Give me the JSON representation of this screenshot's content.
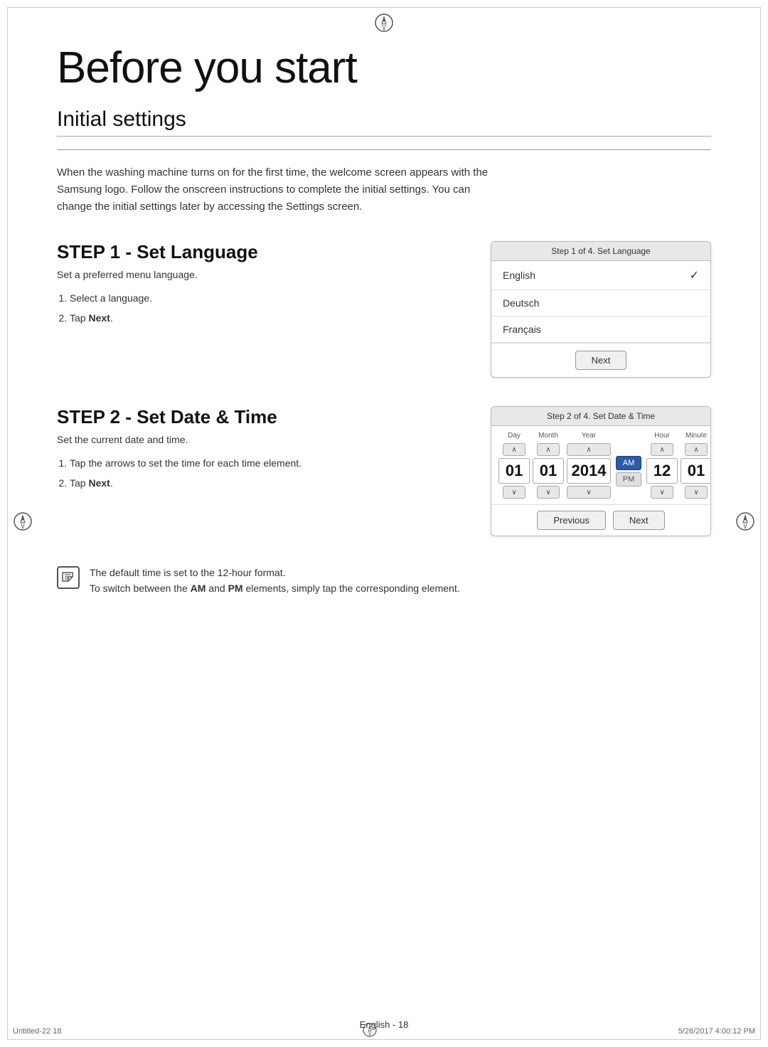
{
  "page": {
    "title": "Before you start",
    "footer": "English - 18",
    "bottom_left": "Untitled-22   18",
    "bottom_right": "5/26/2017   4:00:12 PM"
  },
  "initial_settings": {
    "heading": "Initial settings",
    "intro": "When the washing machine turns on for the first time, the welcome screen appears with the Samsung logo. Follow the onscreen instructions to complete the initial settings. You can change the initial settings later by accessing the Settings screen."
  },
  "step1": {
    "title": "STEP 1 - Set Language",
    "subtitle": "Set a preferred menu language.",
    "instruction1": "Select a language.",
    "instruction2_prefix": "Tap ",
    "instruction2_bold": "Next",
    "instruction2_suffix": ".",
    "ui_header": "Step 1 of 4. Set Language",
    "languages": [
      {
        "name": "English",
        "selected": true
      },
      {
        "name": "Deutsch",
        "selected": false
      },
      {
        "name": "Français",
        "selected": false
      }
    ],
    "next_btn": "Next"
  },
  "step2": {
    "title": "STEP 2 - Set Date & Time",
    "subtitle": "Set the current date and time.",
    "instruction1": "Tap the arrows to set the time for each time element.",
    "instruction2_prefix": "Tap ",
    "instruction2_bold": "Next",
    "instruction2_suffix": ".",
    "ui_header": "Step 2 of 4. Set Date & Time",
    "labels": {
      "day": "Day",
      "month": "Month",
      "year": "Year",
      "hour": "Hour",
      "minute": "Minute"
    },
    "values": {
      "day": "01",
      "month": "01",
      "year": "2014",
      "hour": "12",
      "minute": "01"
    },
    "am_label": "AM",
    "pm_label": "PM",
    "previous_btn": "Previous",
    "next_btn": "Next"
  },
  "note": {
    "line1": "The default time is set to the 12-hour format.",
    "line2_prefix": "To switch between the ",
    "line2_am": "AM",
    "line2_mid": " and ",
    "line2_pm": "PM",
    "line2_suffix": " elements, simply tap the corresponding element."
  }
}
